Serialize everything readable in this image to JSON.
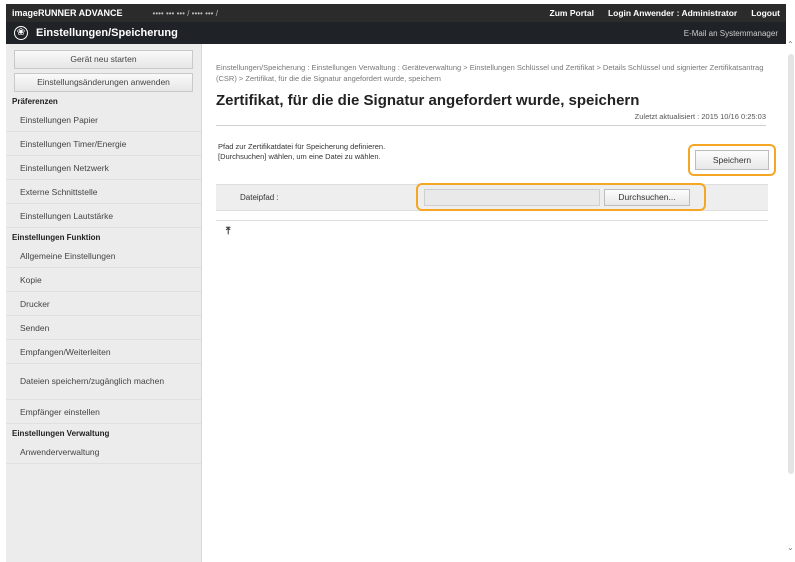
{
  "topbar": {
    "product": "imageRUNNER ADVANCE",
    "device": "•••• ••• ••• / •••• ••• /",
    "portal": "Zum Portal",
    "login_label": "Login Anwender :",
    "login_user": "Administrator",
    "logout": "Logout"
  },
  "header": {
    "title": "Einstellungen/Speicherung",
    "mail": "E-Mail an Systemmanager"
  },
  "sidebar": {
    "restart": "Gerät neu starten",
    "apply": "Einstellungsänderungen anwenden",
    "sections": [
      {
        "title": "Präferenzen",
        "items": [
          "Einstellungen Papier",
          "Einstellungen Timer/Energie",
          "Einstellungen Netzwerk",
          "Externe Schnittstelle",
          "Einstellungen Lautstärke"
        ]
      },
      {
        "title": "Einstellungen Funktion",
        "items": [
          "Allgemeine Einstellungen",
          "Kopie",
          "Drucker",
          "Senden",
          "Empfangen/Weiterleiten",
          "Dateien speichern/zugänglich machen",
          "Empfänger einstellen"
        ]
      },
      {
        "title": "Einstellungen Verwaltung",
        "items": [
          "Anwenderverwaltung"
        ]
      }
    ]
  },
  "main": {
    "breadcrumb": "Einstellungen/Speicherung : Einstellungen Verwaltung : Geräteverwaltung > Einstellungen Schlüssel und Zertifikat > Details Schlüssel und signierter Zertifikatsantrag (CSR) > Zertifikat, für die die Signatur angefordert wurde, speichern",
    "title": "Zertifikat, für die die Signatur angefordert wurde, speichern",
    "updated": "Zuletzt aktualisiert : 2015 10/16 0:25:03",
    "instruction_1": "Pfad zur Zertifikatdatei für Speicherung definieren.",
    "instruction_2": "[Durchsuchen] wählen, um eine Datei zu wählen.",
    "save_label": "Speichern",
    "filepath_label": "Dateipfad :",
    "filepath_value": "",
    "browse_label": "Durchsuchen...",
    "to_top": "↑"
  },
  "colors": {
    "highlight": "#f5a623",
    "header_bg": "#1f2226",
    "sidebar_bg": "#ececec"
  }
}
